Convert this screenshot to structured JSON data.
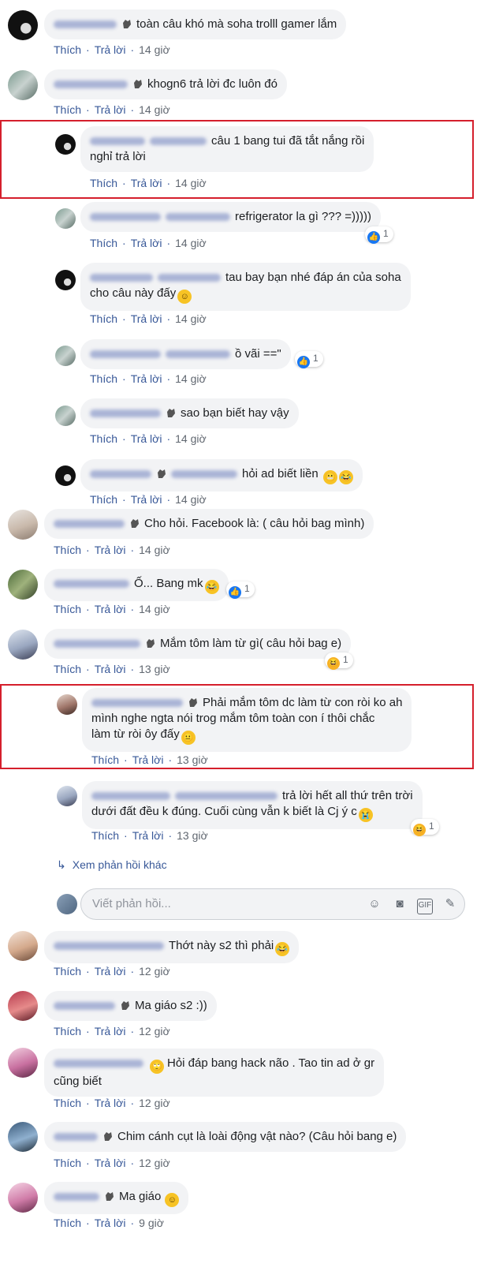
{
  "labels": {
    "like": "Thích",
    "reply": "Trả lời"
  },
  "comments": [
    {
      "text": "toàn câu khó mà soha trolll gamer lắm",
      "time": "14 giờ"
    },
    {
      "text": "khogn6 trả lời đc luôn đó",
      "time": "14 giờ"
    },
    {
      "text": "câu 1 bang tui đã tắt nắng rồi\nnghỉ trả lời",
      "time": "14 giờ"
    },
    {
      "text": "refrigerator la gì ??? =)))))",
      "time": "14 giờ",
      "reaction_count": "1"
    },
    {
      "text": "tau bay bạn nhé đáp án của soha\ncho câu này đấy",
      "time": "14 giờ"
    },
    {
      "text": "ồ vãi ==\"",
      "time": "14 giờ",
      "reaction_count": "1"
    },
    {
      "text": "sao bạn biết hay vậy",
      "time": "14 giờ"
    },
    {
      "text": "hỏi ad biết liền",
      "time": "14 giờ"
    },
    {
      "text": "Cho hỏi. Facebook là: ( câu hỏi bag mình)",
      "time": "14 giờ"
    },
    {
      "text": "Ố... Bang mk",
      "time": "14 giờ",
      "reaction_count": "1"
    },
    {
      "text": "Mắm tôm làm từ gì( câu hỏi bag e)",
      "time": "13 giờ",
      "reaction_count": "1"
    },
    {
      "text": "Phải mắm tôm dc làm từ con ròi ko ah\nmình nghe ngta nói trog mắm tôm toàn con í thôi chắc\nlàm từ ròi ôy đấy",
      "time": "13 giờ"
    },
    {
      "text": "trả lời hết all thứ trên trời\ndưới đất đều k đúng. Cuối cùng vẫn k biết là Cj ý c",
      "time": "13 giờ",
      "reaction_count": "1"
    },
    {
      "text": "Thớt này s2 thì phải",
      "time": "12 giờ"
    },
    {
      "text": "Ma giáo s2 :))",
      "time": "12 giờ"
    },
    {
      "text": "Hỏi đáp bang hack não      . Tao tin ad ở gr\ncũng       biết",
      "time": "12 giờ"
    },
    {
      "text": "Chim cánh cụt là loài động vật nào? (Câu hỏi bang e)",
      "time": "12 giờ"
    },
    {
      "text": "Ma giáo",
      "time": "9 giờ"
    }
  ],
  "more_replies": "Xem phản hồi khác",
  "reply_box": {
    "placeholder": "Viết phản hồi..."
  },
  "icons": [
    "emoji-icon",
    "camera-icon",
    "gif-icon",
    "sticker-icon",
    "reply-arrow-icon"
  ],
  "colors": {
    "link": "#385898",
    "bubble": "#f2f3f5",
    "highlight": "#d51f2c",
    "like": "#1877f2"
  }
}
